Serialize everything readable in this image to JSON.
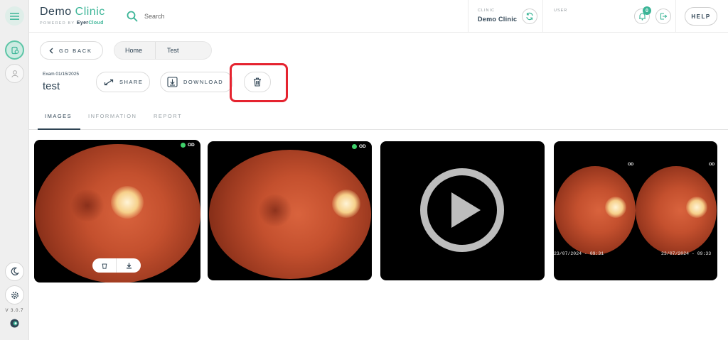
{
  "brand": {
    "title_main": "Demo",
    "title_accent": "Clinic",
    "powered_by": "POWERED BY",
    "company_main": "Eyer",
    "company_accent": "Cloud"
  },
  "search": {
    "placeholder": "Search",
    "value": ""
  },
  "clinic": {
    "label": "CLINIC",
    "name": "Demo Clinic"
  },
  "user": {
    "label": "USER"
  },
  "notifications": {
    "count": "0"
  },
  "help_label": "HELP",
  "sidebar": {
    "version": "V 3.0.7"
  },
  "nav": {
    "go_back": "GO BACK",
    "breadcrumb": [
      "Home",
      "Test"
    ]
  },
  "exam": {
    "date_label": "Exam 01/15/2025",
    "name": "test"
  },
  "actions": {
    "share": "SHARE",
    "download": "DOWNLOAD"
  },
  "tabs": [
    {
      "label": "IMAGES",
      "active": true
    },
    {
      "label": "INFORMATION",
      "active": false
    },
    {
      "label": "REPORT",
      "active": false
    }
  ],
  "thumbnails": [
    {
      "type": "image",
      "eye": "OD"
    },
    {
      "type": "image",
      "eye": "OD"
    },
    {
      "type": "video"
    },
    {
      "type": "composite",
      "eye_left": "OD",
      "eye_right": "OD",
      "timestamp_left": "23/07/2024 - 09:31",
      "timestamp_right": "23/07/2024 - 09:33"
    }
  ],
  "colors": {
    "accent": "#3bb597",
    "highlight": "#e5232f",
    "text": "#2e4353"
  }
}
